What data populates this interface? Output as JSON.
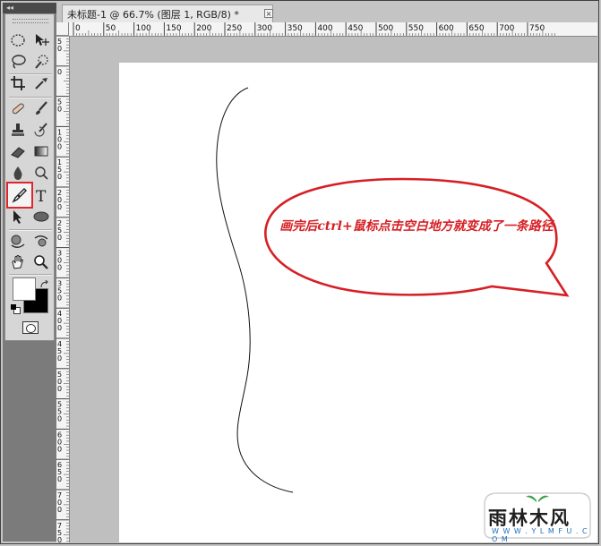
{
  "tab": {
    "title": "未标题-1 @ 66.7% (图层 1, RGB/8) *",
    "close_label": "×"
  },
  "ruler_top_labels": [
    "0",
    "50",
    "100",
    "150",
    "200",
    "250",
    "300",
    "350",
    "400",
    "450",
    "500",
    "550",
    "600",
    "650",
    "700",
    "750"
  ],
  "ruler_left_labels": [
    "50",
    "0",
    "50",
    "100",
    "150",
    "200",
    "250",
    "300",
    "350",
    "400",
    "450",
    "500",
    "550",
    "600",
    "650",
    "700",
    "750"
  ],
  "toolbar": {
    "collapse_glyph": "◂◂",
    "tools": [
      "marquee-icon",
      "move-icon",
      "lasso-icon",
      "quick-select-icon",
      "crop-icon",
      "eyedropper-icon",
      "healing-brush-icon",
      "brush-icon",
      "clone-stamp-icon",
      "history-brush-icon",
      "eraser-icon",
      "gradient-icon",
      "blur-icon",
      "dodge-icon",
      "pen-icon",
      "type-icon",
      "path-selection-icon",
      "shape-icon",
      "3d-rotate-icon",
      "3d-orbit-icon",
      "hand-icon",
      "zoom-icon"
    ],
    "foreground_color": "#ffffff",
    "background_color": "#000000",
    "selected_tool": "pen-icon"
  },
  "annotation": {
    "text": "画完后ctrl+鼠标点击空白地方就变成了一条路径",
    "color": "#d61f24"
  },
  "watermark": {
    "name": "雨林木风",
    "url": "W W W . Y L M F U . C O M"
  }
}
